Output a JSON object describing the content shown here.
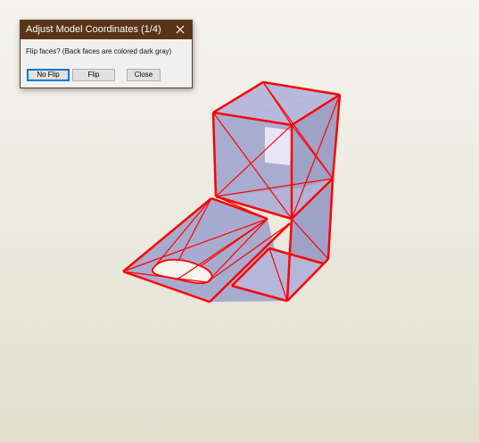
{
  "dialog": {
    "title": "Adjust Model Coordinates (1/4)",
    "message": "Flip faces? (Back faces are colored dark gray)",
    "buttons": {
      "no_flip": "No Flip",
      "flip": "Flip",
      "close": "Close"
    },
    "default_button": "no_flip"
  },
  "viewport": {
    "model_face_color": "#a8acd0",
    "edge_color": "#ff0000",
    "inner_face_color": "#e8e6f6"
  },
  "colors": {
    "titlebar": "#5a3417",
    "dialog_background": "#f0f0f0",
    "accent": "#0078d7"
  }
}
